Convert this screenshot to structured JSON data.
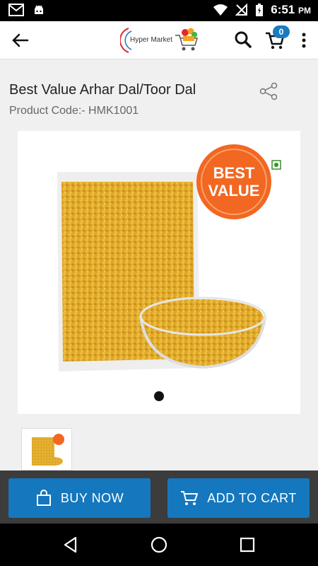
{
  "status_bar": {
    "time": "6:51",
    "ampm": "PM",
    "icons": [
      "gmail-icon",
      "android-icon",
      "wifi-icon",
      "no-signal-icon",
      "battery-charging-icon"
    ]
  },
  "app_bar": {
    "logo_text": "Hyper Market",
    "cart_count": "0",
    "icons": [
      "back-arrow-icon",
      "search-icon",
      "cart-icon",
      "more-vert-icon"
    ]
  },
  "product": {
    "title": "Best Value Arhar Dal/Toor Dal",
    "code": "Product Code:- HMK1001",
    "badge_text": [
      "BEST",
      "VALUE"
    ]
  },
  "actions": {
    "buy_now": "BUY NOW",
    "add_to_cart": "ADD TO CART"
  },
  "colors": {
    "primary": "#1577bd",
    "badge": "#1a7bbf",
    "action_bar": "#3c3c3c",
    "value_badge": "#f26722"
  }
}
